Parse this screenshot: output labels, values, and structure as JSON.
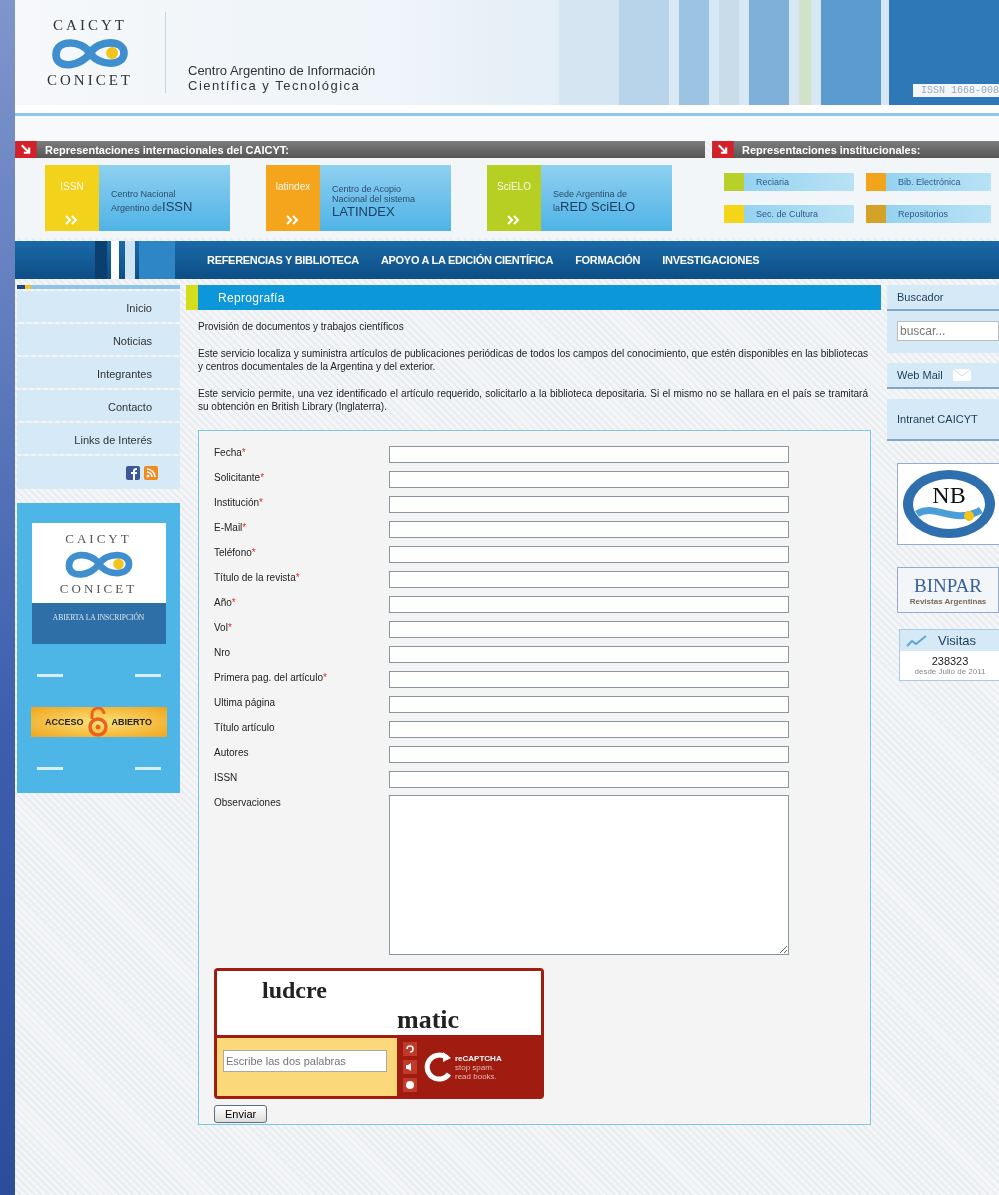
{
  "header": {
    "logo_top": "CAICYT",
    "logo_bottom": "CONICET",
    "title_line1": "Centro Argentino de Información",
    "title_line2": "Científica y Tecnológica",
    "issn": "ISSN 1668-008"
  },
  "representation_bars": [
    "Representaciones internacionales del CAICYT:",
    "Representaciones institucionales:"
  ],
  "banners": [
    {
      "badge": "ISSN",
      "color": "#f2d21b",
      "lines": [
        "Centro Nacional"
      ],
      "prefix": "Argentino de",
      "big": "ISSN"
    },
    {
      "badge": "latindex",
      "color": "#f5a51c",
      "lines": [
        "Centro de Acopio",
        "Nacional del sistema"
      ],
      "big": "LATINDEX"
    },
    {
      "badge": "SciELO",
      "color": "#b7cf22",
      "lines": [
        "Sede Argentina de"
      ],
      "prefix": "la",
      "big": "RED SciELO"
    }
  ],
  "institutional_links": [
    {
      "label": "Reciaria",
      "color": "#b9cf2a"
    },
    {
      "label": "Bib. Electrónica",
      "color": "#f2a51a"
    },
    {
      "label": "Sec. de Cultura",
      "color": "#f5d51a"
    },
    {
      "label": "Repositorios",
      "color": "#d4a227"
    }
  ],
  "nav": [
    "REFERENCIAS Y BIBLIOTECA",
    "APOYO A LA EDICIÓN CIENTÍFICA",
    "FORMACIÓN",
    "INVESTIGACIONES"
  ],
  "sidebar": {
    "menu": [
      "Inicio",
      "Noticias",
      "Integrantes",
      "Contacto",
      "Links de Interés"
    ],
    "promo": {
      "logo_top": "CAICYT",
      "logo_bottom": "CONICET",
      "caption": "ABIERTA LA INSCRIPCIÓN"
    },
    "open_access": {
      "left": "ACCESO",
      "right": "ABIERTO"
    }
  },
  "main": {
    "title": "Reprografía",
    "subtitle": "Provisión de documentos y trabajos científicos",
    "paragraphs": [
      "Este servicio localiza y suministra artículos de publicaciones periódicas de todos los campos del conocimiento, que estén disponibles en las bibliotecas y centros documentales de la Argentina y del exterior.",
      "Este servicio permite, una vez identificado el artículo requerido, solicitarlo a la biblioteca depositaria. Si el mismo no se hallara en el país se tramitará su obtención en British Library (Inglaterra)."
    ],
    "form": {
      "fields": [
        {
          "label": "Fecha",
          "mark": "*",
          "kind": "text"
        },
        {
          "label": "Solicitante",
          "mark": "*",
          "kind": "text"
        },
        {
          "label": "Institución",
          "mark": "*",
          "kind": "text"
        },
        {
          "label": "E-Mail",
          "mark": "*",
          "kind": "text"
        },
        {
          "label": "Teléfono",
          "mark": "*",
          "kind": "text"
        },
        {
          "label": "Título de la revista",
          "mark": "*",
          "kind": "text"
        },
        {
          "label": "Año",
          "mark": "*",
          "kind": "text"
        },
        {
          "label": "Vol",
          "mark": "*",
          "kind": "text"
        },
        {
          "label": "Nro",
          "kind": "text"
        },
        {
          "label": "Primera pag. del artículo",
          "mark": "*",
          "kind": "text"
        },
        {
          "label": "Ultima página",
          "kind": "text"
        },
        {
          "label": "Título artículo",
          "kind": "text"
        },
        {
          "label": "Autores",
          "kind": "text"
        },
        {
          "label": "ISSN",
          "kind": "text"
        },
        {
          "label": "Observaciones",
          "kind": "textarea"
        }
      ],
      "captcha": {
        "words": [
          "ludcre",
          "matic"
        ],
        "placeholder": "Escribe las dos palabras",
        "brand": "reCAPTCHA",
        "tagline": [
          "stop spam.",
          "read books."
        ]
      },
      "submit": "Enviar"
    }
  },
  "right": {
    "search_title": "Buscador",
    "search_placeholder": "buscar...",
    "webmail": "Web Mail",
    "intranet": "Intranet CAICYT",
    "nb": "NB",
    "binpar": "BINPAR",
    "binpar_sub": "Revistas Argentinas",
    "visits_title": "Visitas",
    "visits": "238323",
    "visits_since": "desde Julio de 2011"
  }
}
